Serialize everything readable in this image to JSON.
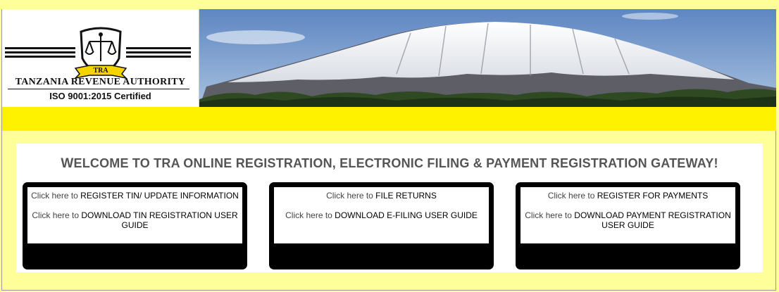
{
  "header": {
    "org_name": "TANZANIA REVENUE AUTHORITY",
    "logo_badge": "TRA",
    "certification": "ISO 9001:2015 Certified"
  },
  "welcome": {
    "first_letter": "W",
    "rest_word": "ELCOME TO ",
    "main": "TRA ONLINE REGISTRATION, ELECTRONIC FILING & PAYMENT REGISTRATION GATEWAY!"
  },
  "cards": [
    {
      "items": [
        {
          "prefix": "Click here to ",
          "link": "REGISTER TIN/ UPDATE INFORMATION"
        },
        {
          "prefix": "Click here to ",
          "link": "DOWNLOAD TIN REGISTRATION USER GUIDE"
        }
      ]
    },
    {
      "items": [
        {
          "prefix": "Click here to ",
          "link": "FILE RETURNS"
        },
        {
          "prefix": "Click here to ",
          "link": "DOWNLOAD E-FILING USER GUIDE"
        }
      ]
    },
    {
      "items": [
        {
          "prefix": "Click here to ",
          "link": "REGISTER FOR PAYMENTS"
        },
        {
          "prefix": "Click here to ",
          "link": "DOWNLOAD PAYMENT REGISTRATION USER GUIDE"
        }
      ]
    }
  ]
}
